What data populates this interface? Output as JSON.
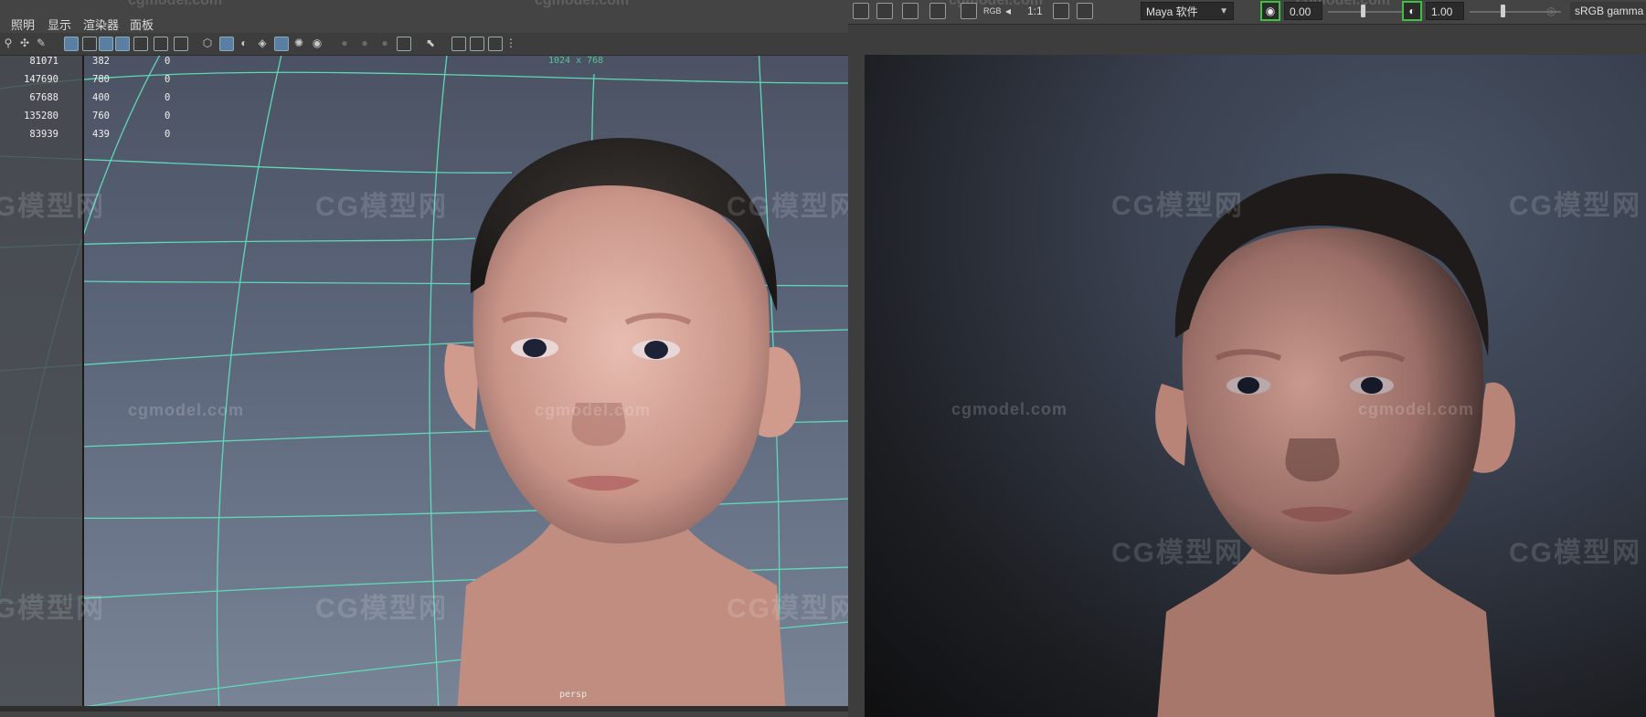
{
  "menu": {
    "lighting": "照明",
    "display": "显示",
    "renderer": "渲染器",
    "panels": "面板"
  },
  "viewport": {
    "resolution": "1024 x 768",
    "camera": "persp",
    "hud_rows": [
      {
        "c1": "81071",
        "c2": "382",
        "c3": "0"
      },
      {
        "c1": "147690",
        "c2": "780",
        "c3": "0"
      },
      {
        "c1": "67688",
        "c2": "400",
        "c3": "0"
      },
      {
        "c1": "135280",
        "c2": "760",
        "c3": "0"
      },
      {
        "c1": "83939",
        "c2": "439",
        "c3": "0"
      }
    ]
  },
  "render_view": {
    "ratio": "1:1",
    "rgb": "RGB",
    "color_space": "Maya 软件",
    "exposure": "0.00",
    "gamma": "1.00",
    "view_transform": "sRGB gamma"
  },
  "watermark": {
    "brand": "CG模型网",
    "url": "cgmodel.com"
  }
}
